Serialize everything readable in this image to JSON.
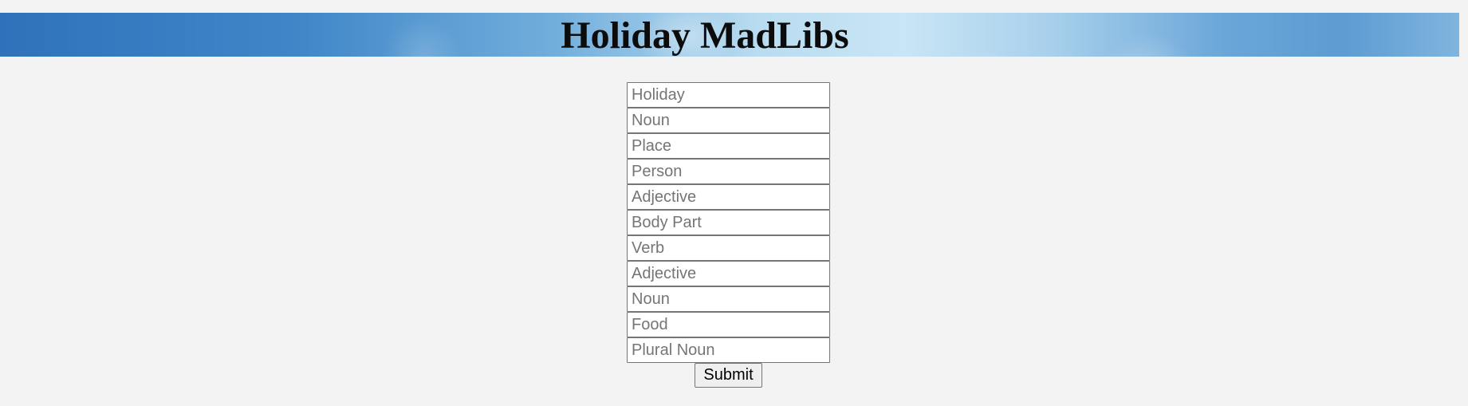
{
  "header": {
    "title": "Holiday MadLibs"
  },
  "form": {
    "fields": [
      {
        "placeholder": "Holiday"
      },
      {
        "placeholder": "Noun"
      },
      {
        "placeholder": "Place"
      },
      {
        "placeholder": "Person"
      },
      {
        "placeholder": "Adjective"
      },
      {
        "placeholder": "Body Part"
      },
      {
        "placeholder": "Verb"
      },
      {
        "placeholder": "Adjective"
      },
      {
        "placeholder": "Noun"
      },
      {
        "placeholder": "Food"
      },
      {
        "placeholder": "Plural Noun"
      }
    ],
    "submit_label": "Submit"
  }
}
